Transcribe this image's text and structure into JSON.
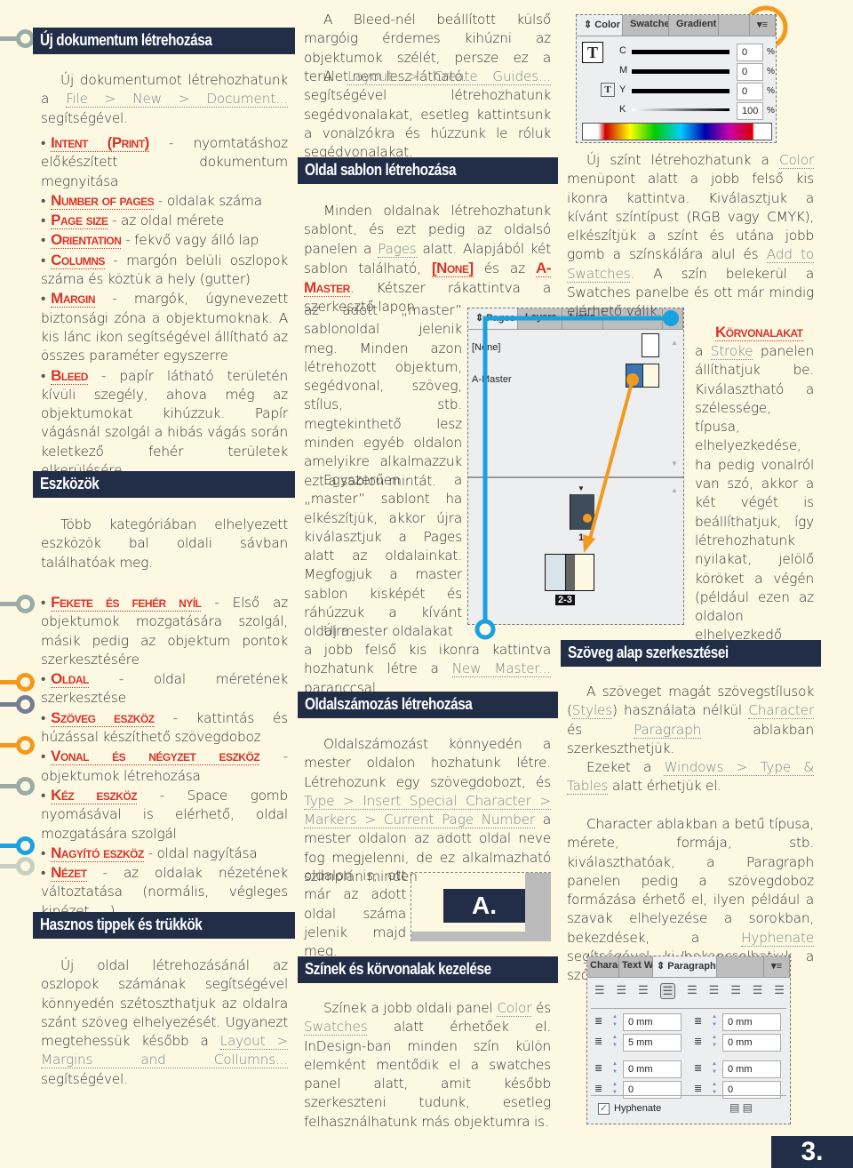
{
  "colors": {
    "header_bg": "#222e48",
    "keyword": "#d8352a",
    "blue": "#1aa2e0",
    "orange": "#f39a1e",
    "grey_green": "#9aaca5",
    "slate": "#757c95"
  },
  "col1": {
    "h1": "Új dokumentum létrehozása",
    "intro": [
      "Új dokumentumot létrehozhatunk a ",
      "File > New > Document...",
      " segítségével."
    ],
    "items": [
      {
        "kw": "Intent (Print)",
        "text": " - nyomtatáshoz előkészített dokumentum megnyitása"
      },
      {
        "kw": "Number of pages",
        "text": " - oldalak száma"
      },
      {
        "kw": "Page size",
        "text": " - az oldal mérete"
      },
      {
        "kw": "Orientation",
        "text": " - fekvő vagy álló lap"
      },
      {
        "kw": "Columns",
        "text": " - margón belüli oszlopok száma és köztük a hely (gutter)"
      },
      {
        "kw": "Margin",
        "text": " - margók, úgynevezett biztonsági zóna a objektumoknak. A kis lánc ikon segítségével állítható az összes paraméter egyszerre"
      },
      {
        "kw": "Bleed",
        "text": " - papír látható területén kívüli szegély, ahova még az objektumokat kihúzzuk. Papír vágásnál szolgál a hibás vágás során keletkező fehér területek elkerülésére."
      }
    ],
    "h2": "Eszközök",
    "tools_intro": "Több kategóriában elhelyezett eszközök bal oldali sávban találhatóak meg.",
    "tools": [
      {
        "kw": "Fekete és fehér nyíl",
        "text": " - Első az objektumok mozgatására szolgál, másik pedig az objektum pontok szerkesztésére"
      },
      {
        "kw": "Oldal",
        "text": " - oldal méretének szerkesztése"
      },
      {
        "kw": "Szöveg eszköz",
        "text": " - kattintás és húzással készíthető szövegdoboz"
      },
      {
        "kw": "Vonal és négyzet eszköz",
        "text": " - objektumok létrehozása"
      },
      {
        "kw": "Kéz eszköz",
        "text": " - Space gomb nyomásával is elérhető, oldal mozgatására szolgál"
      },
      {
        "kw": "Nagyító eszköz",
        "text": " - oldal nagyítása"
      },
      {
        "kw": "Nézet",
        "text": " - az oldalak nézetének változtatása (normális, végleges kinézet, ...)"
      }
    ],
    "h3": "Hasznos tippek és trükkök",
    "tips": [
      "Új oldal létrehozásánál az oszlopok számának segítségével könnyedén szétoszthatjuk az oldalra szánt szöveg elhelyezését. Ugyanezt megtehessük később a ",
      "Layout > Margins and Collumns...",
      " segítségével."
    ]
  },
  "col2": {
    "bleed_p": "A Bleed-nél beállított külső margóig érdemes kihúzni az objektumok szélét, persze ez a terület nem lesz látható.",
    "guides_p": [
      "A ",
      "Layout > Create Guides...",
      " segítségével létrehozhatunk segédvonalakat, esetleg kattintsunk a vonalzókra és húzzunk le róluk segédvonalakat."
    ],
    "h1": "Oldal sablon létrehozása",
    "sablon_p1": [
      "Minden oldalnak létrehozhatunk sablont, és ezt pedig az oldalsó panelen a ",
      "Pages",
      " alatt. Alapjából két sablon található, ",
      "[None]",
      " és az ",
      "A-Master",
      ". Kétszer rákattintva a szerkesztő lapon"
    ],
    "sablon_p2": "az adott „master” sablonoldal jelenik meg. Minden azon létrehozott objektum, segédvonal, szöveg, stílus, stb. megtekinthető lesz minden egyéb oldalon amelyikre alkalmazzuk ezt a sablon mintát.",
    "sablon_p3": "Egyszerűen a „master” sablont ha elkészítjük, akkor újra kiválasztjuk a Pages alatt az oldalainkat. Megfogjuk a master sablon kisképét és ráhúzzuk a kívánt oldalra.",
    "sablon_p4a": "Új mester oldalakat",
    "sablon_p4b": [
      "a jobb felső kis ikonra kattintva hozhatunk létre a ",
      "New Master...",
      " paranccsal."
    ],
    "h2": "Oldalszámozás létrehozása",
    "num_p": [
      "Oldalszámozást könnyedén a mester oldalon hozhatunk létre. Létrehozunk egy szövegdobozt, és ",
      "Type > Insert Special Character > Markers > Current Page Number",
      " a mester oldalon az adott oldal neve fog megjelenni, de ez alkalmazható szimplán minden"
    ],
    "num_p2": "oldalon is, ott már az adott oldal száma jelenik majd meg.",
    "num_sample": "A.",
    "h3": "Színek és körvonalak kezelése",
    "colors_p": [
      "Színek a jobb oldali panel ",
      "Color",
      " és ",
      "Swatches",
      " alatt érhetőek el. InDesign-ban minden szín külön elemként mentődik el a swatches panel alatt, amit később szerkeszteni tudunk, esetleg felhasználhatunk más objektumra is."
    ]
  },
  "pages_panel": {
    "tabs": [
      "Pages",
      "Layers",
      "Links"
    ],
    "masters": [
      "[None]",
      "A-Master"
    ],
    "page1_label": "1",
    "spread_label": "2-3"
  },
  "color_panel": {
    "tabs": [
      "Color",
      "Swatches",
      "Gradient"
    ],
    "channels": [
      {
        "label": "C",
        "value": "0",
        "unit": "%"
      },
      {
        "label": "M",
        "value": "0",
        "unit": "%"
      },
      {
        "label": "Y",
        "value": "0",
        "unit": "%"
      },
      {
        "label": "K",
        "value": "100",
        "unit": "%"
      }
    ]
  },
  "col3": {
    "new_color_p": [
      "Új színt létrehozhatunk a ",
      "Color",
      " menüpont alatt a jobb felső kis ikonra kattintva. Kiválasztjuk a kívánt színtípust (RGB vagy CMYK), elkészítjük a színt és utána jobb gomb a színskálára alul és ",
      "Add to Swatches",
      ". A szín belekerül a Swatches panelbe és ott már mindig elérhető válik."
    ],
    "stroke_kw": "Körvonalakat",
    "stroke_p": [
      "a ",
      "Stroke",
      " panelen állíthatjuk be. Kiválasztható a szélessége, típusa, elhelyezkedése, ha pedig vonalról van szó, akkor a két végét is beállíthatjuk, így létrehozhatunk nyilakat, jelölő köröket a végén (például ezen az oldalon elhelyezkedő vonalak."
    ],
    "h1": "Szöveg alap szerkesztései",
    "text_p1": [
      "A szöveget magát szövegstílusok (",
      "Styles",
      ") használata nélkül ",
      "Character",
      " és ",
      "Paragraph",
      " ablakban szerkeszthetjük."
    ],
    "text_p2": [
      "Ezeket a ",
      "Windows > Type & Tables",
      " alatt érhetjük el."
    ],
    "text_p3": [
      "Character ablakban a betű típusa, mérete, formája, stb. kiválaszthatóak, a Paragraph panelen pedig a szövegdoboz formázása érhető el, ilyen például a szavak elhelyezése a sorokban, bekezdések, a ",
      "Hyphenate",
      " segítségével ki-/bekapcsolhatjuk a szótagolást."
    ]
  },
  "para_panel": {
    "tabs": [
      "Charac",
      "Text W",
      "Paragraph"
    ],
    "fields_left": [
      "0 mm",
      "5 mm",
      "0 mm",
      "0"
    ],
    "fields_right": [
      "0 mm",
      "0 mm",
      "0 mm",
      "0"
    ],
    "hyphenate_label": "Hyphenate",
    "hyphenate_checked": true
  },
  "page_number": "3."
}
